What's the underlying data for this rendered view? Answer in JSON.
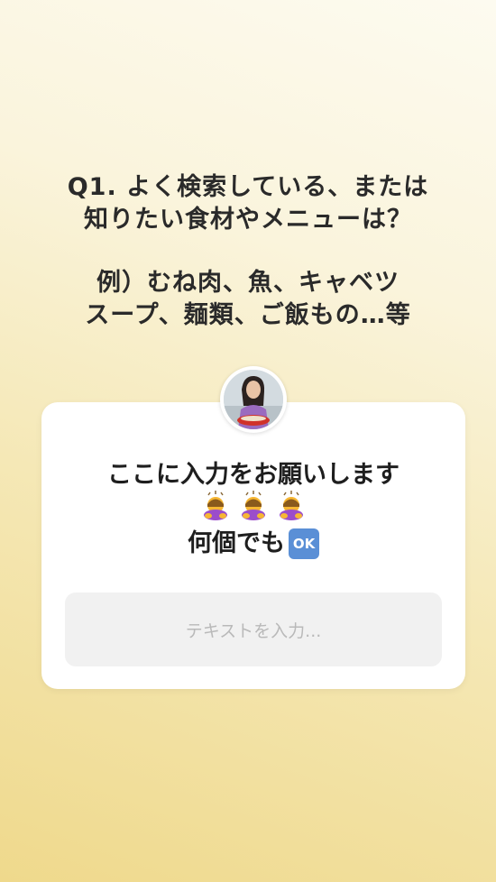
{
  "question": {
    "line1": "Q1. よく検索している、または",
    "line2": "知りたい食材やメニューは？",
    "line3": "例）むね肉、魚、キャベツ",
    "line4": "スープ、麺類、ご飯もの…等"
  },
  "card": {
    "prompt_line1": "ここに入力をお願いします",
    "emoji_icons": [
      "person-bowing-icon",
      "person-bowing-icon",
      "person-bowing-icon"
    ],
    "prompt_line3": "何個でも",
    "ok_badge": "OK",
    "input_placeholder": "テキストを入力..."
  },
  "colors": {
    "background_warm": "#efd98c",
    "background_light": "#fdfbf0",
    "ok_badge": "#5a8fd6"
  }
}
